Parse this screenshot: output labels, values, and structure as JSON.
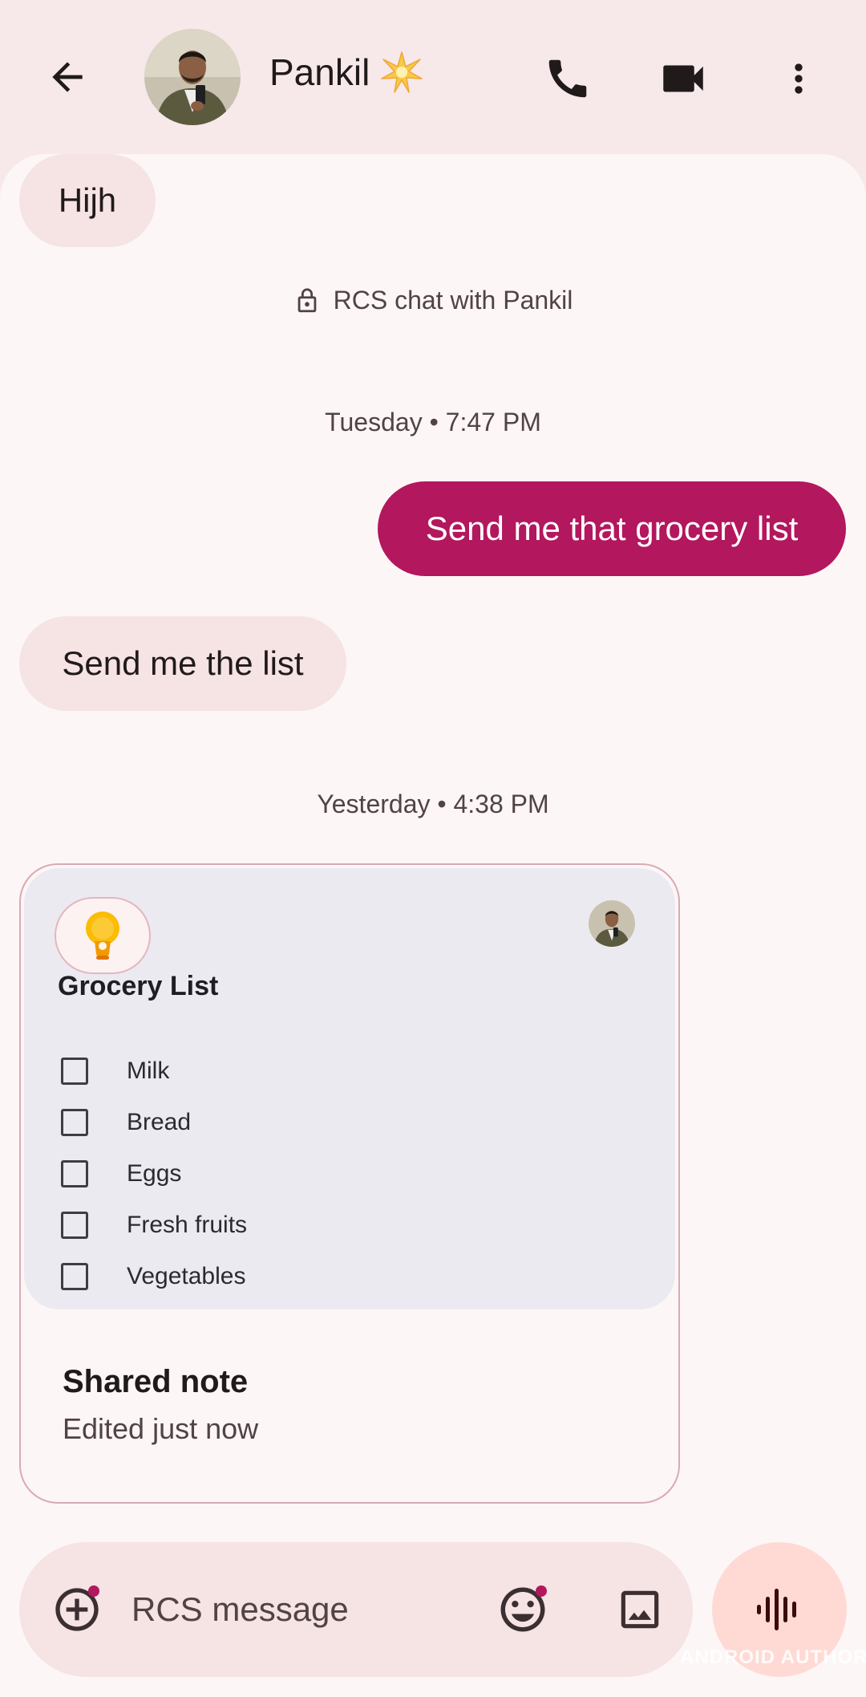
{
  "header": {
    "contact_name": "Pankil",
    "icons": [
      "back-arrow-icon",
      "call-icon",
      "video-call-icon",
      "more-vert-icon"
    ]
  },
  "messages": {
    "incoming_1": "Hijh",
    "encryption_note": "RCS chat with Pankil",
    "timestamp_1": "Tuesday • 7:47 PM",
    "outgoing_1": "Send me that grocery list",
    "incoming_2": "Send me the list",
    "timestamp_2": "Yesterday • 4:38 PM"
  },
  "note_card": {
    "title": "Grocery List",
    "items": [
      {
        "label": "Milk",
        "checked": false
      },
      {
        "label": "Bread",
        "checked": false
      },
      {
        "label": "Eggs",
        "checked": false
      },
      {
        "label": "Fresh fruits",
        "checked": false
      },
      {
        "label": "Vegetables",
        "checked": false
      }
    ],
    "shared_title": "Shared note",
    "shared_subtitle": "Edited just now"
  },
  "composer": {
    "placeholder": "RCS message",
    "icons": [
      "add-icon",
      "emoji-icon",
      "gallery-icon",
      "voice-waveform-icon"
    ]
  },
  "watermark": "ANDROID AUTHORITY",
  "colors": {
    "accent": "#b3175e",
    "header_bg": "#f7e9ea",
    "chat_bg": "#fdf6f6",
    "incoming_bubble": "#f6e3e4",
    "card_inner": "#eceaf1",
    "voice_button": "#ffdad5"
  }
}
